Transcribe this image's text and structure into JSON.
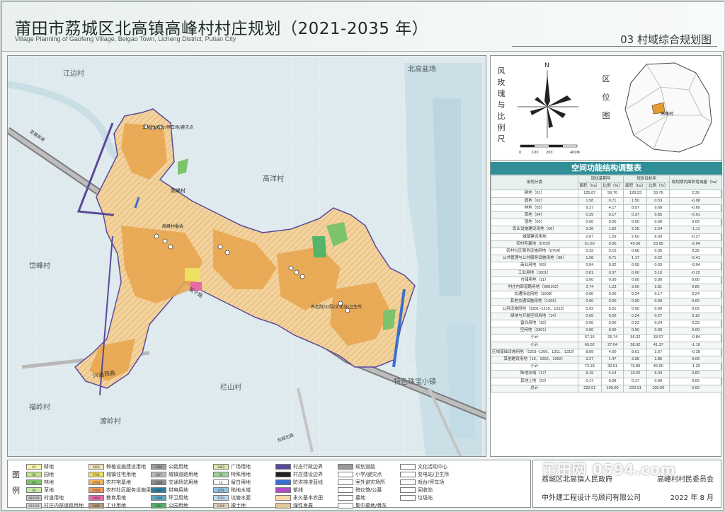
{
  "header": {
    "title": "莆田市荔城区北高镇高峰村村庄规划（2021-2035 年）",
    "subtitle": "Village Planning of Gaofeng Village, Beigao Town, Licheng District, Putian City",
    "sheet": "03 村域综合规划图"
  },
  "map_labels": {
    "jiangbian": "江边村",
    "beigaoyanchang": "北高盐场",
    "gaoyang": "高洋村",
    "daifeng": "岱峰村",
    "shanshan": "栏山村",
    "fuling": "福岭村",
    "duling": "渡岭村",
    "zhubao": "特色珠宝小镇",
    "village_center": "高峰村",
    "road_1": "兴涵西路",
    "road_2": "延宁路",
    "road_3": "龙城北路",
    "road_4": "至莆高速",
    "poi_1": "文化站/戏台/停车场/避灾点",
    "poi_2": "高峰村委会",
    "poi_3": "养老院/公厕/文化站/卫生所"
  },
  "side": {
    "compass_label": "风玫瑰与比例尺",
    "north": "N",
    "scale": [
      "0",
      "100",
      "200",
      "400M"
    ],
    "location_label": "区位图",
    "location_marker": "高峰村"
  },
  "land_table": {
    "title": "空间功能结构调整表",
    "headers": [
      "用地分类",
      "现状基期年",
      "规划目标年",
      "规划期内面积增减量（ha）"
    ],
    "subheaders": [
      "面积（ha）",
      "比例（%）",
      "面积（ha）",
      "比例（%）"
    ],
    "rows": [
      {
        "name": "耕地（01）",
        "v": [
          "125.87",
          "56.70",
          "128.23",
          "33.76",
          "2.36"
        ]
      },
      {
        "name": "园地（02）",
        "v": [
          "1.58",
          "0.71",
          "1.50",
          "0.53",
          "-0.08"
        ]
      },
      {
        "name": "林地（03）",
        "v": [
          "9.27",
          "4.17",
          "8.57",
          "9.68",
          "-0.69"
        ]
      },
      {
        "name": "草地（04）",
        "v": [
          "0.39",
          "0.17",
          "0.37",
          "0.85",
          "-0.01"
        ]
      },
      {
        "name": "湿地（05）",
        "v": [
          "0.00",
          "0.00",
          "0.00",
          "0.00",
          "0.00"
        ]
      },
      {
        "name": "农业设施建设用地（06）",
        "v": [
          "3.36",
          "1.52",
          "2.25",
          "2.24",
          "-1.11"
        ]
      },
      {
        "name": "城镇建设用地",
        "v": [
          "2.87",
          "1.29",
          "2.60",
          "8.30",
          "-0.27"
        ]
      },
      {
        "name": "农村宅基地（0703）",
        "v": [
          "51.60",
          "0.00",
          "49.56",
          "23.85",
          "-2.04"
        ]
      },
      {
        "name": "农村社区服务设施用地（0704）",
        "v": [
          "0.33",
          "0.15",
          "0.68",
          "0.35",
          "0.35"
        ]
      },
      {
        "name": "公共管理与公共服务设施用地（08）",
        "v": [
          "1.58",
          "0.71",
          "1.17",
          "0.22",
          "-0.41"
        ]
      },
      {
        "name": "商业用地（09）",
        "v": [
          "0.04",
          "0.02",
          "0.00",
          "0.03",
          "-0.04"
        ]
      },
      {
        "name": "工业用地（1001）",
        "v": [
          "0.81",
          "0.37",
          "0.60",
          "5.10",
          "-0.22"
        ]
      },
      {
        "name": "仓储用地（11）",
        "v": [
          "0.00",
          "0.00",
          "0.00",
          "0.00",
          "0.00"
        ]
      },
      {
        "name": "村庄内部道路用地（060102）",
        "v": [
          "2.74",
          "1.23",
          "3.60",
          "2.81",
          "0.86"
        ]
      },
      {
        "name": "交通场站用地（1208）",
        "v": [
          "0.00",
          "0.00",
          "0.24",
          "0.17",
          "0.24"
        ]
      },
      {
        "name": "其他交通设施用地（1209）",
        "v": [
          "0.00",
          "0.00",
          "0.00",
          "0.00",
          "0.00"
        ]
      },
      {
        "name": "公用设施用地（1301~1310，1313）",
        "v": [
          "0.02",
          "0.01",
          "0.00",
          "0.00",
          "0.02"
        ]
      },
      {
        "name": "绿地与开敞空间用地（14）",
        "v": [
          "0.05",
          "0.02",
          "0.24",
          "0.27",
          "0.19"
        ]
      },
      {
        "name": "留白用地（16）",
        "v": [
          "0.00",
          "0.00",
          "0.23",
          "0.24",
          "0.23"
        ]
      },
      {
        "name": "空闲地（2301）",
        "v": [
          "0.00",
          "0.00",
          "0.00",
          "0.00",
          "0.00"
        ]
      },
      {
        "name": "小计",
        "v": [
          "57.16",
          "25.74",
          "56.32",
          "33.07",
          "-0.84"
        ]
      },
      {
        "name": "小计",
        "v": [
          "60.02",
          "27.04",
          "58.92",
          "41.37",
          "-1.10"
        ]
      },
      {
        "name": "区域基础设施用地（1201~1206，1311，1312）",
        "v": [
          "8.89",
          "4.00",
          "8.61",
          "2.67",
          "-0.28"
        ]
      },
      {
        "name": "其他建设用地（15，1002，1003）",
        "v": [
          "3.27",
          "1.47",
          "3.36",
          "2.85",
          "0.09"
        ]
      },
      {
        "name": "小计",
        "v": [
          "72.18",
          "32.51",
          "70.89",
          "46.90",
          "-1.29"
        ]
      },
      {
        "name": "陆地水域（17）",
        "v": [
          "9.19",
          "4.14",
          "10.02",
          "6.04",
          "0.82"
        ]
      },
      {
        "name": "其他土地（23）",
        "v": [
          "0.17",
          "0.08",
          "0.17",
          "0.00",
          "0.00"
        ]
      },
      {
        "name": "总计",
        "v": [
          "222.01",
          "100.00",
          "222.01",
          "100.00",
          "0.00"
        ]
      }
    ]
  },
  "legend": {
    "title": "图例",
    "items": [
      {
        "code": "01",
        "label": "耕地",
        "color": "#f7f2a6"
      },
      {
        "code": "02",
        "label": "园地",
        "color": "#bfe08a"
      },
      {
        "code": "03",
        "label": "林地",
        "color": "#7cc36b"
      },
      {
        "code": "04",
        "label": "草地",
        "color": "#c7e6a3"
      },
      {
        "code": "060102",
        "label": "村道用地",
        "color": "#c8c8c8"
      },
      {
        "code": "060102",
        "label": "村庄内部道路用地",
        "color": "#d8d8d8"
      },
      {
        "code": "0602",
        "label": "种植设施建设用地",
        "color": "#f6e7b8"
      },
      {
        "code": "0701",
        "label": "城镇住宅用地",
        "color": "#f0e061"
      },
      {
        "code": "0703",
        "label": "农村宅基地",
        "color": "#f2b663"
      },
      {
        "code": "0704",
        "label": "农村社区服务设施用地",
        "color": "#f29b5a"
      },
      {
        "code": "0804",
        "label": "教育用地",
        "color": "#e56aa8"
      },
      {
        "code": "1001",
        "label": "工业用地",
        "color": "#b79a79"
      },
      {
        "code": "1202",
        "label": "公路用地",
        "color": "#9e9e9e"
      },
      {
        "code": "1207",
        "label": "城镇道路用地",
        "color": "#bdbdbd"
      },
      {
        "code": "1208",
        "label": "交通场站用地",
        "color": "#8e8e8e"
      },
      {
        "code": "1301",
        "label": "供电用地",
        "color": "#2d7f9d"
      },
      {
        "code": "1309",
        "label": "环卫用地",
        "color": "#5aa9c6"
      },
      {
        "code": "1401",
        "label": "公园用地",
        "color": "#56b36a"
      },
      {
        "code": "1403",
        "label": "广场用地",
        "color": "#d9e9a7"
      },
      {
        "code": "15",
        "label": "特殊用地",
        "color": "#9fcf9d"
      },
      {
        "code": "16",
        "label": "留白用地",
        "color": "#ffffff"
      },
      {
        "code": "1701",
        "label": "陆地水域",
        "color": "#8fc3e3"
      },
      {
        "code": "1703",
        "label": "坑塘水面",
        "color": "#b6d8ec"
      },
      {
        "code": "2306",
        "label": "裸土地",
        "color": "#e1d3bd"
      },
      {
        "code": "",
        "label": "村庄行政边界",
        "color": "#5a4a9a"
      },
      {
        "code": "",
        "label": "村庄建设边界",
        "color": "#222222"
      },
      {
        "code": "",
        "label": "防洪排涝蓝线",
        "color": "#3a6fd0"
      },
      {
        "code": "",
        "label": "紫线",
        "color": "#b14bc7"
      },
      {
        "code": "",
        "label": "永久基本农田",
        "color": "#f5d9a8"
      },
      {
        "code": "",
        "label": "弹性发展",
        "color": "#e4c69b"
      },
      {
        "code": "",
        "label": "规划道路",
        "color": "#999999"
      },
      {
        "code": "",
        "label": "小学/避灾点",
        "color": "#ffffff"
      },
      {
        "code": "",
        "label": "室外避灾场所",
        "color": "#ffffff"
      },
      {
        "code": "",
        "label": "殡仪馆/公墓",
        "color": "#ffffff"
      },
      {
        "code": "",
        "label": "墓地",
        "color": "#ffffff"
      },
      {
        "code": "",
        "label": "集中墓地/骨灰",
        "color": "#ffffff"
      },
      {
        "code": "",
        "label": "文化活动中心",
        "color": "#ffffff"
      },
      {
        "code": "",
        "label": "变电站/卫生所",
        "color": "#ffffff"
      },
      {
        "code": "",
        "label": "戏台/停车场",
        "color": "#ffffff"
      },
      {
        "code": "",
        "label": "回收站",
        "color": "#ffffff"
      },
      {
        "code": "",
        "label": "垃圾站",
        "color": "#ffffff"
      }
    ]
  },
  "footer": {
    "gov": "荔城区北高镇人民政府",
    "committee": "高峰村村民委员会",
    "designer": "中外建工程设计与顾问有限公司",
    "date": "2022 年 8 月"
  },
  "watermark": "莆田网 0594.com"
}
